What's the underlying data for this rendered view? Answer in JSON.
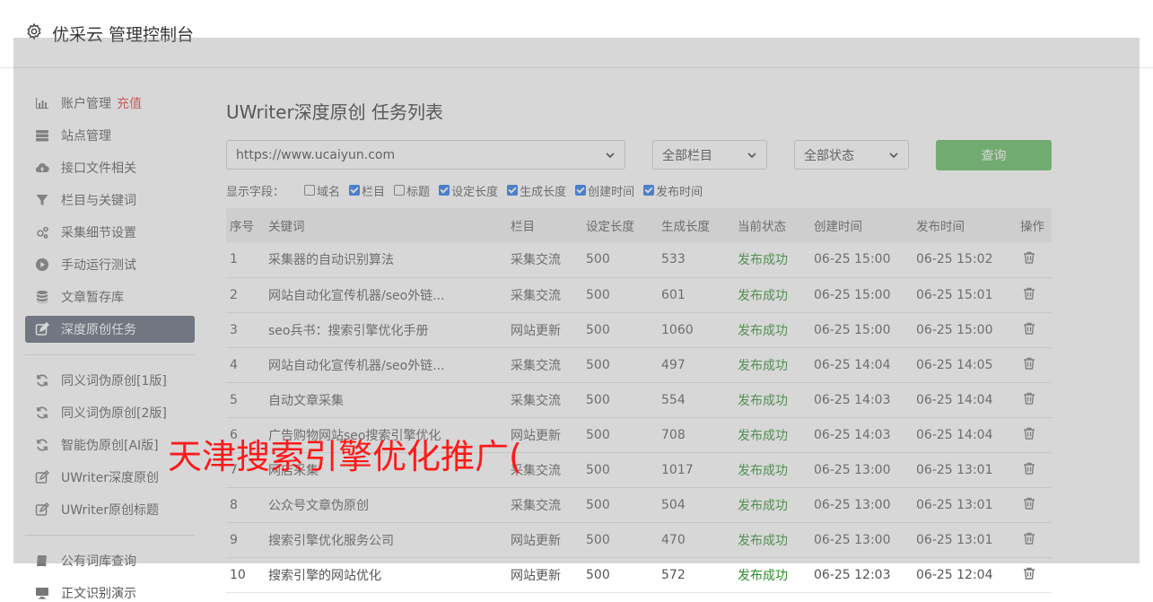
{
  "header": {
    "title": "优采云 管理控制台"
  },
  "sidebar": {
    "items": [
      {
        "label": "账户管理",
        "badge": "充值"
      },
      {
        "label": "站点管理"
      },
      {
        "label": "接口文件相关"
      },
      {
        "label": "栏目与关键词"
      },
      {
        "label": "采集细节设置"
      },
      {
        "label": "手动运行测试"
      },
      {
        "label": "文章暂存库"
      },
      {
        "label": "深度原创任务"
      },
      {
        "label": "同义词伪原创[1版]"
      },
      {
        "label": "同义词伪原创[2版]"
      },
      {
        "label": "智能伪原创[AI版]"
      },
      {
        "label": "UWriter深度原创"
      },
      {
        "label": "UWriter原创标题"
      },
      {
        "label": "公有词库查询"
      },
      {
        "label": "正文识别演示"
      }
    ]
  },
  "main": {
    "title": "UWriter深度原创 任务列表",
    "filters": {
      "site": "https://www.ucaiyun.com",
      "column": "全部栏目",
      "status": "全部状态",
      "query_label": "查询"
    },
    "fields": {
      "label": "显示字段：",
      "options": [
        {
          "label": "域名",
          "checked": false
        },
        {
          "label": "栏目",
          "checked": true
        },
        {
          "label": "标题",
          "checked": false
        },
        {
          "label": "设定长度",
          "checked": true
        },
        {
          "label": "生成长度",
          "checked": true
        },
        {
          "label": "创建时间",
          "checked": true
        },
        {
          "label": "发布时间",
          "checked": true
        }
      ]
    },
    "table": {
      "headers": [
        "序号",
        "关键词",
        "栏目",
        "设定长度",
        "生成长度",
        "当前状态",
        "创建时间",
        "发布时间",
        "操作"
      ],
      "rows": [
        {
          "no": "1",
          "keyword": "采集器的自动识别算法",
          "column": "采集交流",
          "set": "500",
          "gen": "533",
          "status": "发布成功",
          "created": "06-25 15:00",
          "published": "06-25 15:02"
        },
        {
          "no": "2",
          "keyword": "网站自动化宣传机器/seo外链...",
          "column": "采集交流",
          "set": "500",
          "gen": "601",
          "status": "发布成功",
          "created": "06-25 15:00",
          "published": "06-25 15:01"
        },
        {
          "no": "3",
          "keyword": "seo兵书：搜索引擎优化手册",
          "column": "网站更新",
          "set": "500",
          "gen": "1060",
          "status": "发布成功",
          "created": "06-25 15:00",
          "published": "06-25 15:00"
        },
        {
          "no": "4",
          "keyword": "网站自动化宣传机器/seo外链...",
          "column": "采集交流",
          "set": "500",
          "gen": "497",
          "status": "发布成功",
          "created": "06-25 14:04",
          "published": "06-25 14:05"
        },
        {
          "no": "5",
          "keyword": "自动文章采集",
          "column": "采集交流",
          "set": "500",
          "gen": "554",
          "status": "发布成功",
          "created": "06-25 14:03",
          "published": "06-25 14:04"
        },
        {
          "no": "6",
          "keyword": "广告购物网站seo搜索引擎优化",
          "column": "网站更新",
          "set": "500",
          "gen": "708",
          "status": "发布成功",
          "created": "06-25 14:03",
          "published": "06-25 14:04"
        },
        {
          "no": "7",
          "keyword": "网店采集",
          "column": "采集交流",
          "set": "500",
          "gen": "1017",
          "status": "发布成功",
          "created": "06-25 13:00",
          "published": "06-25 13:01"
        },
        {
          "no": "8",
          "keyword": "公众号文章伪原创",
          "column": "采集交流",
          "set": "500",
          "gen": "504",
          "status": "发布成功",
          "created": "06-25 13:00",
          "published": "06-25 13:01"
        },
        {
          "no": "9",
          "keyword": "搜索引擎优化服务公司",
          "column": "网站更新",
          "set": "500",
          "gen": "470",
          "status": "发布成功",
          "created": "06-25 13:00",
          "published": "06-25 13:01"
        },
        {
          "no": "10",
          "keyword": "搜索引擎的网站优化",
          "column": "网站更新",
          "set": "500",
          "gen": "572",
          "status": "发布成功",
          "created": "06-25 12:03",
          "published": "06-25 12:04"
        }
      ]
    }
  },
  "watermark": {
    "text": "天津搜索引擎优化推广("
  },
  "colors": {
    "active_nav": "#5a6474",
    "query_button": "#5cb85c",
    "success": "#2e8b2e",
    "badge": "#e23b3b",
    "watermark": "#ff1a1a"
  }
}
